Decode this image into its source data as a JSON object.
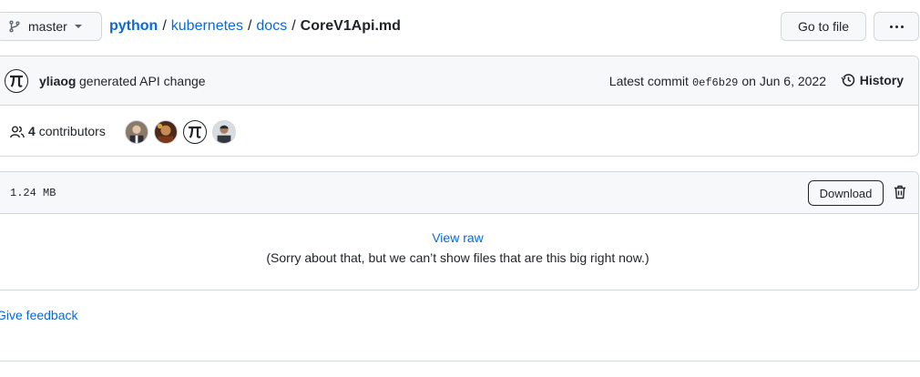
{
  "topbar": {
    "branch": "master",
    "breadcrumb": {
      "repo": "python",
      "path": [
        "kubernetes",
        "docs"
      ],
      "separator": "/",
      "file": "CoreV1Api.md"
    },
    "goto_label": "Go to file",
    "more_icon": "kebab-horizontal-icon"
  },
  "commit": {
    "author": "yliaog",
    "message": "generated API change",
    "latest_prefix": "Latest commit",
    "sha": "0ef6b29",
    "date": "on Jun 6, 2022",
    "history_label": "History"
  },
  "contributors": {
    "count": "4",
    "label": "contributors"
  },
  "file": {
    "size": "1.24 MB",
    "download_label": "Download",
    "view_raw": "View raw",
    "sorry": "(Sorry about that, but we can’t show files that are this big right now.)"
  },
  "feedback": "Give feedback",
  "colors": {
    "link": "#0969da",
    "border": "#d0d7de",
    "header_bg": "#f6f8fa",
    "text": "#1f2328"
  }
}
